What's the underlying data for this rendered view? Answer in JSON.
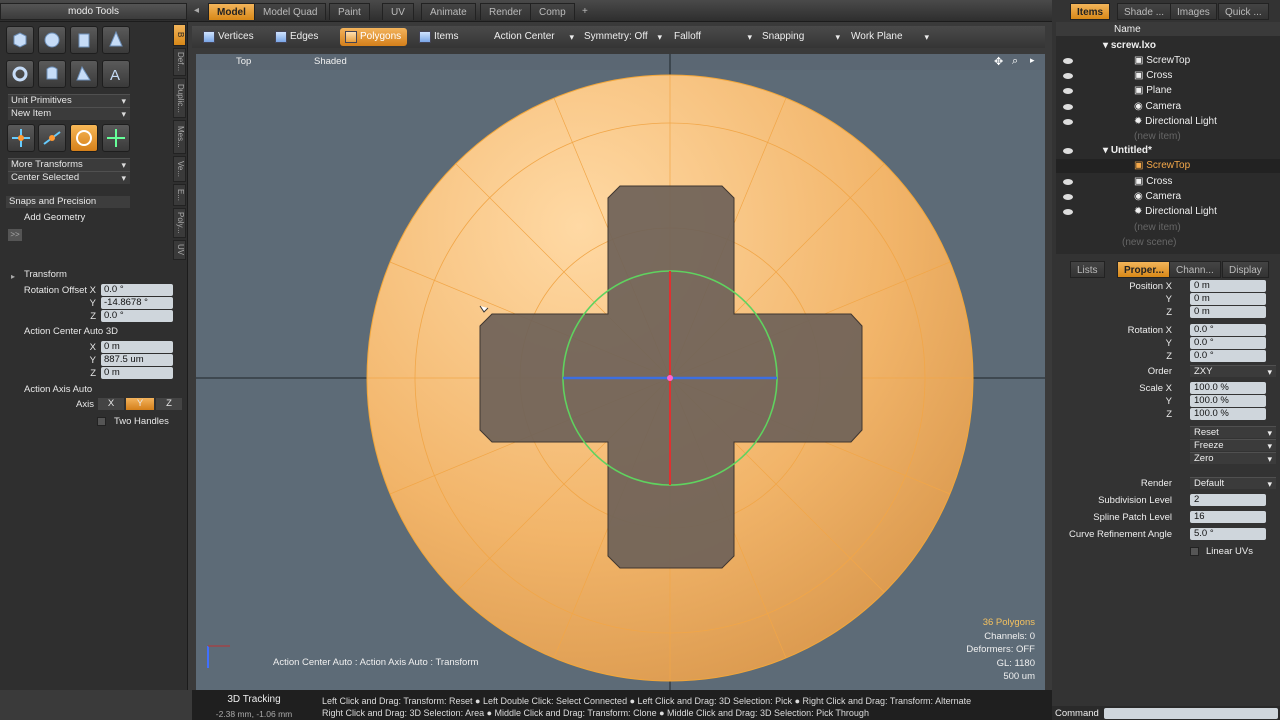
{
  "left": {
    "title": "modo Tools",
    "unit_primitives": "Unit Primitives",
    "new_item": "New Item",
    "more_transforms": "More Transforms",
    "center_selected": "Center Selected",
    "snaps": "Snaps and Precision",
    "add_geometry": "Add Geometry",
    "more_btn": ">>",
    "side_tabs": [
      "Def...",
      "Duplic...",
      "Mes...",
      "Ve...",
      "E...",
      "Poly...",
      "UV"
    ],
    "transform_title": "Transform",
    "rotation_offset_label": "Rotation Offset X",
    "rot_x": "0.0 °",
    "rot_y": "-14.8678 °",
    "rot_z": "0.0 °",
    "ac_title": "Action Center Auto 3D",
    "ac_x": "0 m",
    "ac_y": "887.5 um",
    "ac_z": "0 m",
    "aa_title": "Action Axis Auto",
    "axis_label": "Axis",
    "axis_x": "X",
    "axis_y": "Y",
    "axis_z": "Z",
    "two_handles": "Two Handles",
    "x": "X",
    "y": "Y",
    "z": "Z"
  },
  "tabs": [
    "Model",
    "Model Quad",
    "Paint",
    "UV",
    "Animate",
    "Render",
    "Comp",
    "+"
  ],
  "toolbar": {
    "vertices": "Vertices",
    "edges": "Edges",
    "polygons": "Polygons",
    "items": "Items",
    "action_center": "Action Center",
    "symmetry": "Symmetry: Off",
    "falloff": "Falloff",
    "snapping": "Snapping",
    "work_plane": "Work Plane"
  },
  "viewport": {
    "view_label": "Top",
    "shade_label": "Shaded",
    "hint": "Action Center Auto : Action Axis Auto : Transform",
    "stats": {
      "polygons": "36 Polygons",
      "channels": "Channels: 0",
      "deformers": "Deformers: OFF",
      "gl": "GL: 1180",
      "scale": "500 um"
    }
  },
  "status": {
    "mode": "3D Tracking",
    "coords": "-2.38 mm, -1.06 mm",
    "line1": "Left Click and Drag: Transform: Reset ● Left Double Click: Select Connected ● Left Click and Drag: 3D Selection: Pick ● Right Click and Drag: Transform: Alternate",
    "line2": "Right Click and Drag: 3D Selection: Area ● Middle Click and Drag: Transform: Clone ● Middle Click and Drag: 3D Selection: Pick Through"
  },
  "right": {
    "tabs": [
      "Items",
      "Shade ...",
      "Images",
      "Quick ..."
    ],
    "name_header": "Name",
    "tree": [
      "screw.lxo",
      "ScrewTop",
      "Cross",
      "Plane",
      "Camera",
      "Directional Light",
      "(new item)",
      "Untitled*",
      "ScrewTop",
      "Cross",
      "Camera",
      "Directional Light",
      "(new item)",
      "(new scene)"
    ],
    "prop_tabs": [
      "Lists",
      "Proper...",
      "Chann...",
      "Display"
    ],
    "position_label": "Position X",
    "pos_x": "0 m",
    "pos_y": "0 m",
    "pos_z": "0 m",
    "rotation_label": "Rotation X",
    "rot_x": "0.0 °",
    "rot_y": "0.0 °",
    "rot_z": "0.0 °",
    "order_label": "Order",
    "order": "ZXY",
    "scale_label": "Scale X",
    "scale_x": "100.0 %",
    "scale_y": "100.0 %",
    "scale_z": "100.0 %",
    "reset": "Reset",
    "freeze": "Freeze",
    "zero": "Zero",
    "render_label": "Render",
    "render": "Default",
    "subdiv_label": "Subdivision Level",
    "subdiv": "2",
    "spline_label": "Spline Patch Level",
    "spline": "16",
    "curve_label": "Curve Refinement Angle",
    "curve": "5.0 °",
    "linear_uvs": "Linear UVs",
    "y": "Y",
    "z": "Z",
    "command_label": "Command"
  }
}
